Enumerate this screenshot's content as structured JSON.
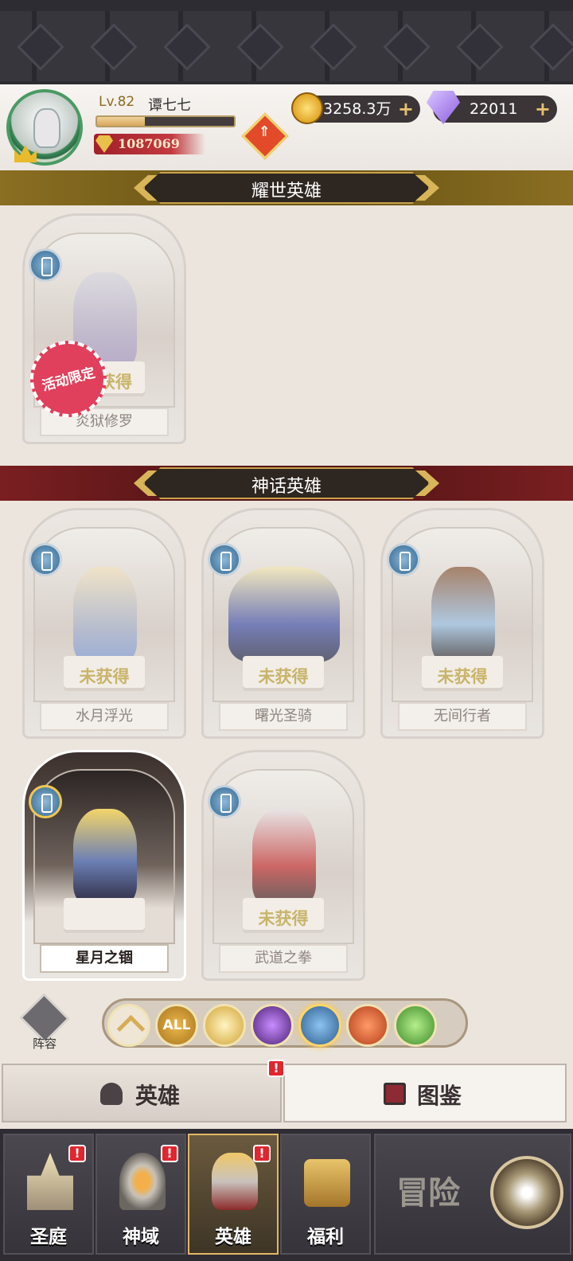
{
  "header": {
    "level": "Lv.82",
    "player_name": "谭七七",
    "xp_progress": 0.35,
    "power": "1087069",
    "gold": "3258.3万",
    "gems": "22011",
    "plus_glyph": "+"
  },
  "sections": {
    "glory": {
      "title": "耀世英雄"
    },
    "myth": {
      "title": "神话英雄"
    }
  },
  "limited_tag": "活动限定",
  "glory_heroes": [
    {
      "name": "炎狱修罗",
      "status": "获得",
      "owned": false
    }
  ],
  "myth_heroes": [
    {
      "name": "水月浮光",
      "status": "未获得",
      "owned": false
    },
    {
      "name": "曙光圣骑",
      "status": "未获得",
      "owned": false
    },
    {
      "name": "无间行者",
      "status": "未获得",
      "owned": false
    },
    {
      "name": "星月之锢",
      "status": "",
      "owned": true
    },
    {
      "name": "武道之拳",
      "status": "未获得",
      "owned": false
    }
  ],
  "lineup_label": "阵容",
  "filters": {
    "all_label": "ALL"
  },
  "tabs": {
    "hero": "英雄",
    "book": "图鉴"
  },
  "alert_glyph": "!",
  "nav": [
    {
      "label": "圣庭"
    },
    {
      "label": "神域"
    },
    {
      "label": "英雄"
    },
    {
      "label": "福利"
    }
  ],
  "adventure_label": "冒险",
  "colors": {
    "accent_gold": "#d8b558",
    "alert_red": "#e0262e",
    "myth_banner": "#531416",
    "glory_banner": "#6b5616"
  }
}
